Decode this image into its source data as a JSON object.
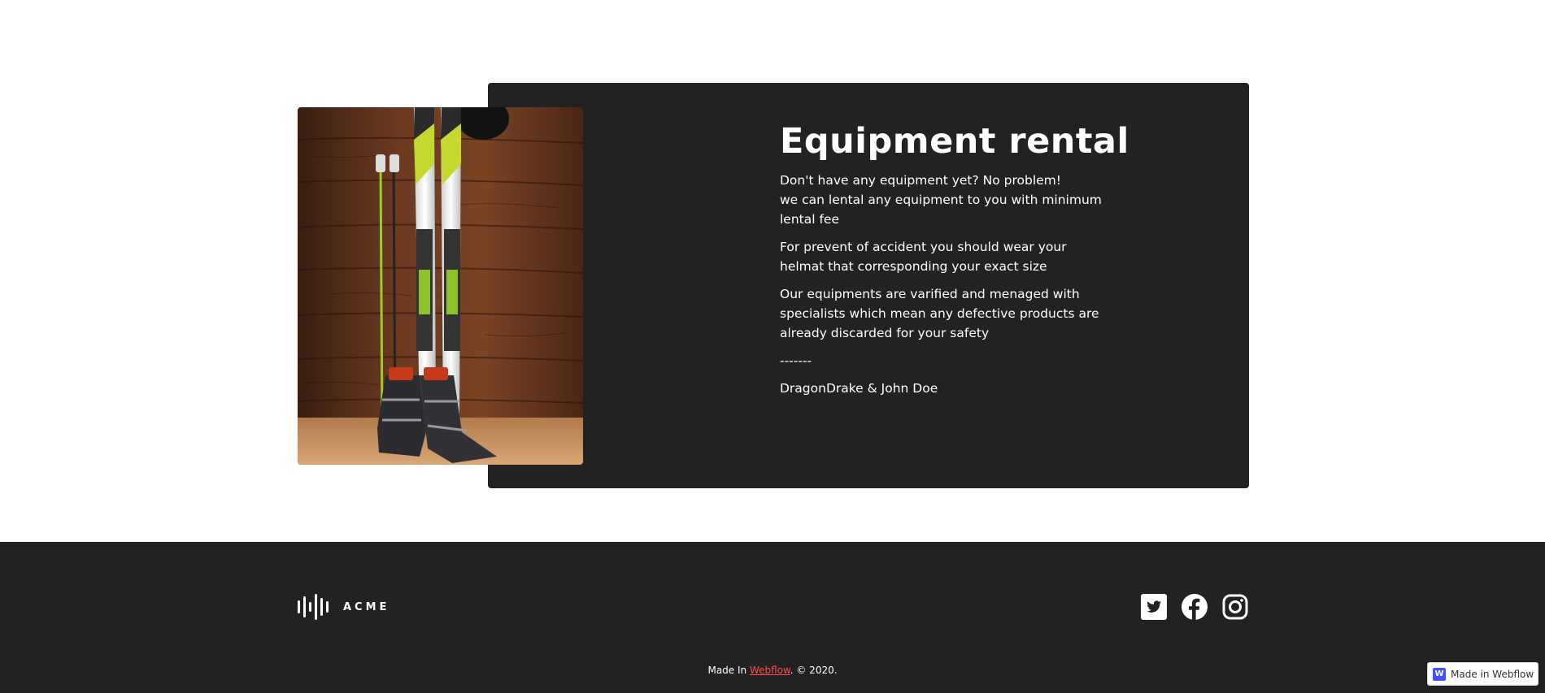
{
  "rental": {
    "heading": "Equipment rental",
    "paragraphs": [
      "Don't have any equipment yet? No problem!\nwe can lental any equipment to you with minimum lental fee",
      "For prevent of accident you should wear your helmat that corresponding your exact size",
      "Our equipments are varified and menaged with specialists which mean any defective products are already discarded for your safety",
      "-------",
      "DragonDrake & John Doe"
    ],
    "image_icon": "ski-equipment-photo"
  },
  "footer": {
    "brand": "ACME",
    "brand_icon": "soundwave-logo-icon",
    "socials": [
      "twitter-icon",
      "facebook-icon",
      "instagram-icon"
    ],
    "copyright_prefix": "Made In ",
    "copyright_link": "Webflow",
    "copyright_suffix": ". © 2020."
  },
  "badge": {
    "logo": "W",
    "label": "Made in Webflow"
  },
  "colors": {
    "panel": "#222222",
    "footer": "#222222",
    "link": "#ff4d4d",
    "webflow_blue": "#4353ff"
  }
}
